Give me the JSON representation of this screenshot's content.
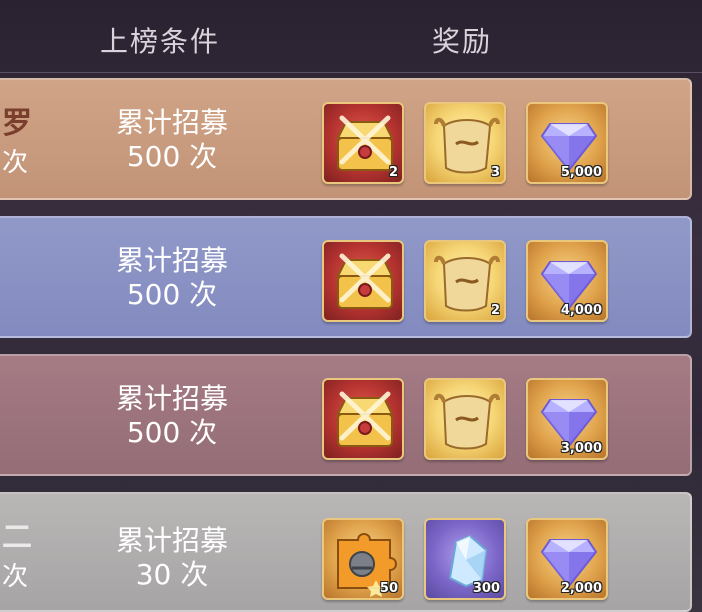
{
  "header": {
    "condition": "上榜条件",
    "reward": "奖励"
  },
  "rows": [
    {
      "edge_top": "罗",
      "edge_bottom": "次",
      "condition_line1": "累计招募",
      "condition_line2": "500 次",
      "rewards": [
        {
          "icon": "treasure-chest",
          "qty": "2"
        },
        {
          "icon": "scroll",
          "qty": "3"
        },
        {
          "icon": "diamond",
          "qty": "5,000"
        }
      ]
    },
    {
      "condition_line1": "累计招募",
      "condition_line2": "500 次",
      "rewards": [
        {
          "icon": "treasure-chest",
          "qty": ""
        },
        {
          "icon": "scroll",
          "qty": "2"
        },
        {
          "icon": "diamond",
          "qty": "4,000"
        }
      ]
    },
    {
      "condition_line1": "累计招募",
      "condition_line2": "500 次",
      "rewards": [
        {
          "icon": "treasure-chest",
          "qty": ""
        },
        {
          "icon": "scroll",
          "qty": ""
        },
        {
          "icon": "diamond",
          "qty": "3,000"
        }
      ]
    },
    {
      "edge_top": "二",
      "edge_bottom": "次",
      "condition_line1": "累计招募",
      "condition_line2": "30 次",
      "rewards": [
        {
          "icon": "puzzle-piece",
          "qty": "50"
        },
        {
          "icon": "ice-crystal",
          "qty": "300"
        },
        {
          "icon": "diamond",
          "qty": "2,000"
        }
      ]
    }
  ]
}
